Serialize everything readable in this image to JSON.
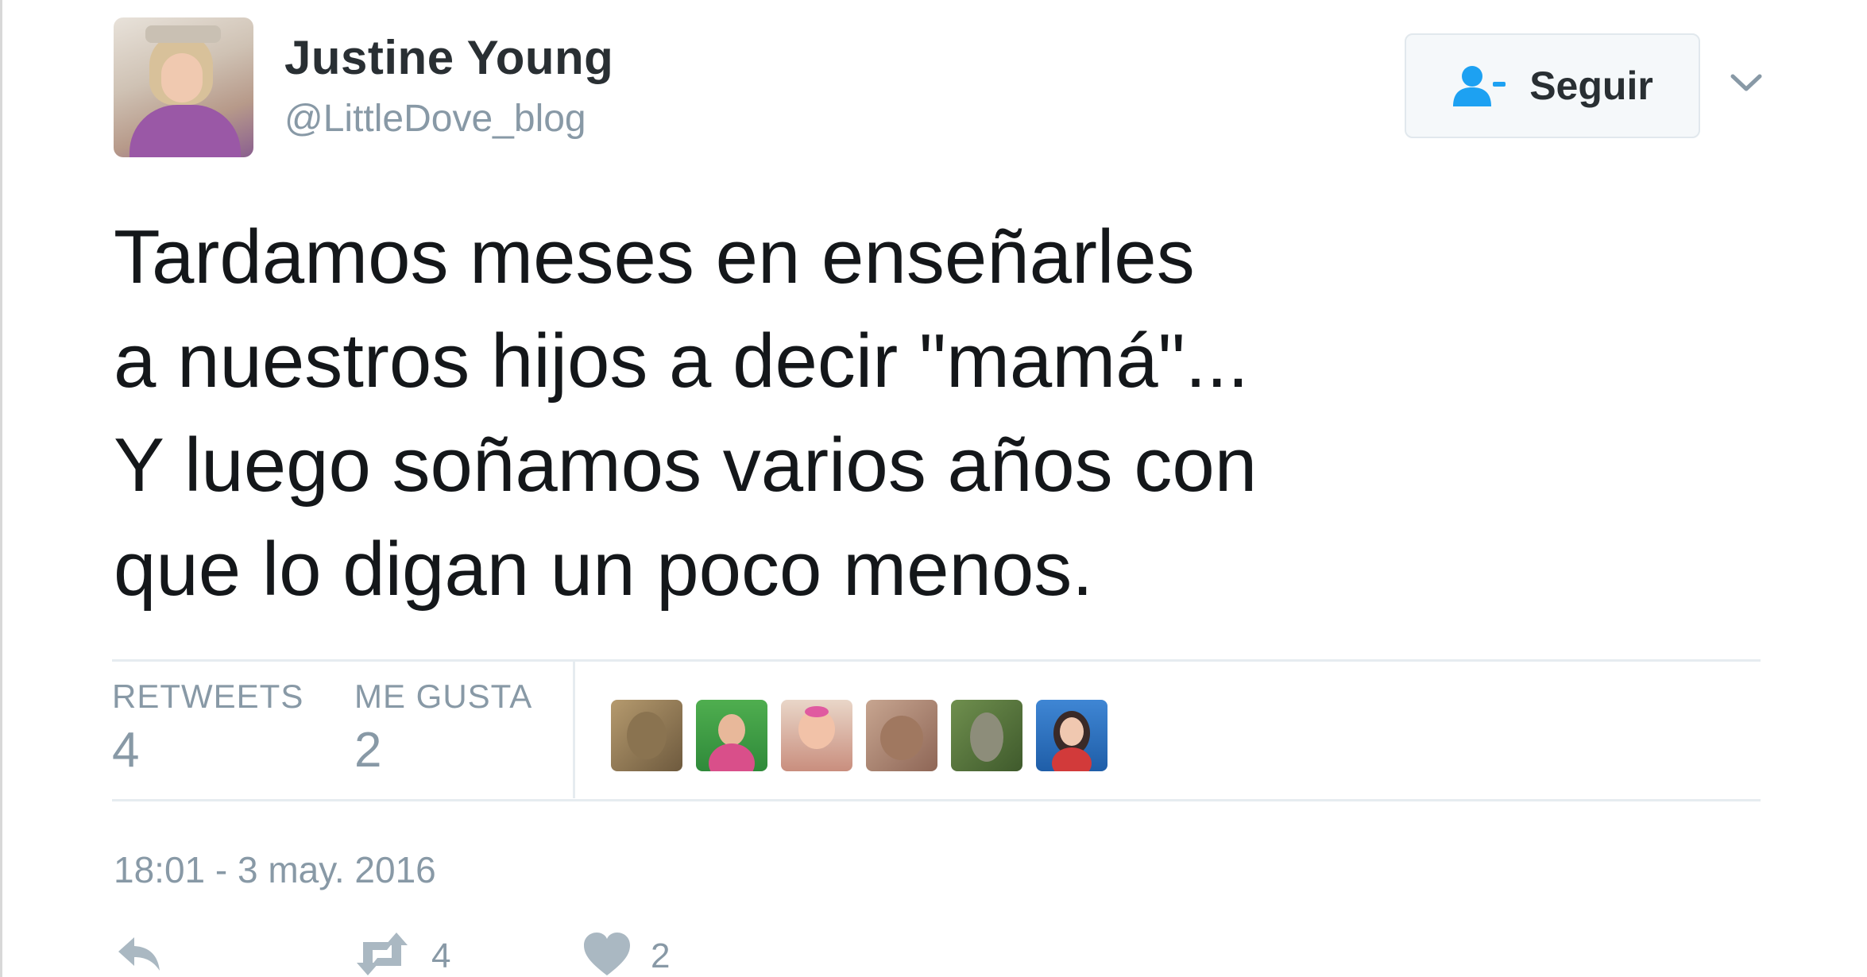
{
  "tweet": {
    "author_name": "Justine Young",
    "author_handle": "@LittleDove_blog",
    "text": "Tardamos meses en enseñarles\na nuestros hijos a decir \"mamá\"...\nY luego soñamos varios años con\nque lo digan un poco menos.",
    "timestamp": "18:01 - 3 may. 2016"
  },
  "follow": {
    "label": "Seguir"
  },
  "stats": {
    "retweets_label": "RETWEETS",
    "retweets_count": "4",
    "likes_label": "ME GUSTA",
    "likes_count": "2"
  },
  "actions": {
    "retweet_count": "4",
    "like_count": "2"
  },
  "colors": {
    "accent": "#1da1f2",
    "text": "#14171a",
    "muted": "#8899a6",
    "divider": "#e6ecf0"
  },
  "icons": {
    "follow": "add-user-icon",
    "more": "chevron-down-icon",
    "reply": "reply-icon",
    "retweet": "retweet-icon",
    "like": "heart-icon"
  }
}
